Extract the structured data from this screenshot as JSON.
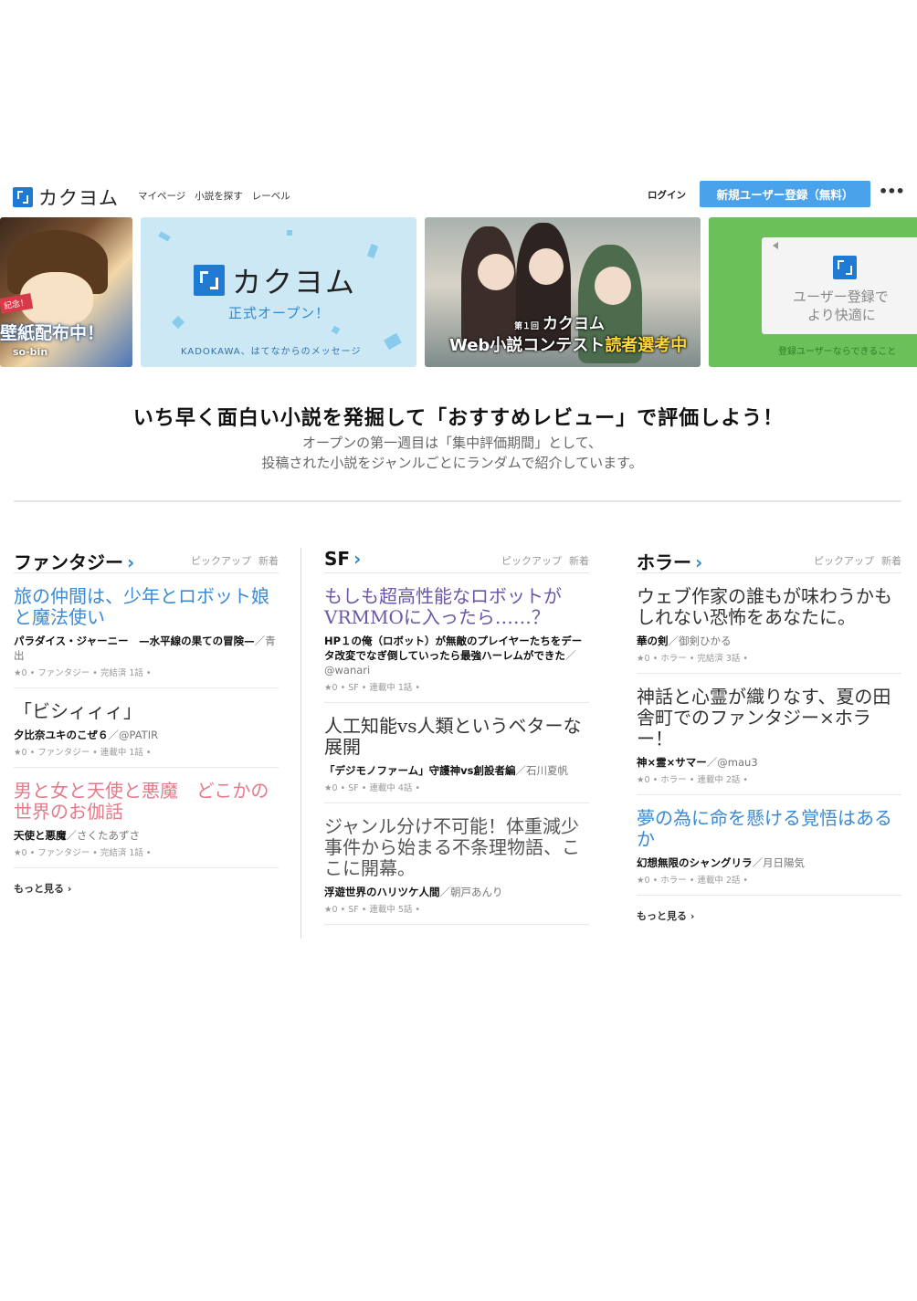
{
  "header": {
    "logo_text": "カクヨム",
    "nav": [
      "マイページ",
      "小説を探す",
      "レーベル"
    ],
    "login": "ログイン",
    "signup": "新規ユーザー登録（無料）",
    "more": "•••"
  },
  "banners": {
    "b1": {
      "tag": "記念！",
      "title": "壁紙配布中！",
      "artist": "so-bin"
    },
    "b2": {
      "title": "カクヨム",
      "subtitle": "正式オープン！",
      "caption": "KADOKAWA、はてなからのメッセージ"
    },
    "b3": {
      "small": "第１回",
      "brand": "カクヨム",
      "line_a": "Web小説コンテスト",
      "line_b": "読者選考中"
    },
    "b4": {
      "line1": "ユーザー登録で",
      "line2": "より快適に",
      "caption": "登録ユーザーならできること"
    }
  },
  "intro": {
    "title": "いち早く面白い小説を発掘して「おすすめレビュー」で評価しよう！",
    "sub1": "オープンの第一週目は「集中評価期間」として、",
    "sub2": "投稿された小説をジャンルごとにランダムで紹介しています。"
  },
  "columns": [
    {
      "title": "ファンタジー",
      "tabs": [
        "ピックアップ",
        "新着"
      ],
      "works": [
        {
          "title": "旅の仲間は、少年とロボット娘と魔法使い",
          "name": "パラダイス・ジャーニー　—水平線の果ての冒険—",
          "author": "／青出",
          "stats": "★0 • ファンタジー • 完結済 1話 •"
        },
        {
          "title": "「ビシィィィ」",
          "name": "夕比奈ユキのこぜ６",
          "author": "／@PATIR",
          "stats": "★0 • ファンタジー • 連載中 1話 •"
        },
        {
          "title": "男と女と天使と悪魔　どこかの世界のお伽話",
          "name": "天使と悪魔",
          "author": "／さくたあずさ",
          "stats": "★0 • ファンタジー • 完結済 1話 •"
        }
      ],
      "more": "もっと見る ›"
    },
    {
      "title": "SF",
      "tabs": [
        "ピックアップ",
        "新着"
      ],
      "works": [
        {
          "title": "もしも超高性能なロボットがVRMMOに入ったら……？",
          "name": "HP１の俺（ロボット）が無敵のプレイヤーたちをデータ改変でなぎ倒していったら最強ハーレムができた",
          "author": "／@wanari",
          "stats": "★0 • SF • 連載中 1話 •"
        },
        {
          "title": "人工知能vs人類というベターな展開",
          "name": "「デジモノファーム」守護神vs創設者編",
          "author": "／石川夏帆",
          "stats": "★0 • SF • 連載中 4話 •"
        },
        {
          "title": "ジャンル分け不可能！体重減少事件から始まる不条理物語、ここに開幕。",
          "name": "浮遊世界のハリツケ人間",
          "author": "／朝戸あんり",
          "stats": "★0 • SF • 連載中 5話 •"
        }
      ],
      "more": ""
    },
    {
      "title": "ホラー",
      "tabs": [
        "ピックアップ",
        "新着"
      ],
      "works": [
        {
          "title": "ウェブ作家の誰もが味わうかもしれない恐怖をあなたに。",
          "name": "華の剣",
          "author": "／御剣ひかる",
          "stats": "★0 • ホラー • 完結済 3話 •"
        },
        {
          "title": "神話と心霊が織りなす、夏の田舎町でのファンタジー×ホラー！",
          "name": "神×霊×サマー",
          "author": "／@mau3",
          "stats": "★0 • ホラー • 連載中 2話 •"
        },
        {
          "title": "夢の為に命を懸ける覚悟はあるか",
          "name": "幻想無限のシャングリラ",
          "author": "／月日陽気",
          "stats": "★0 • ホラー • 連載中 2話 •"
        }
      ],
      "more": "もっと見る ›"
    }
  ],
  "colors": {
    "accent": "#4aa3ea",
    "link_blue": "#3a8ad6",
    "purple": "#6c57a6",
    "pink": "#e47a8a"
  }
}
